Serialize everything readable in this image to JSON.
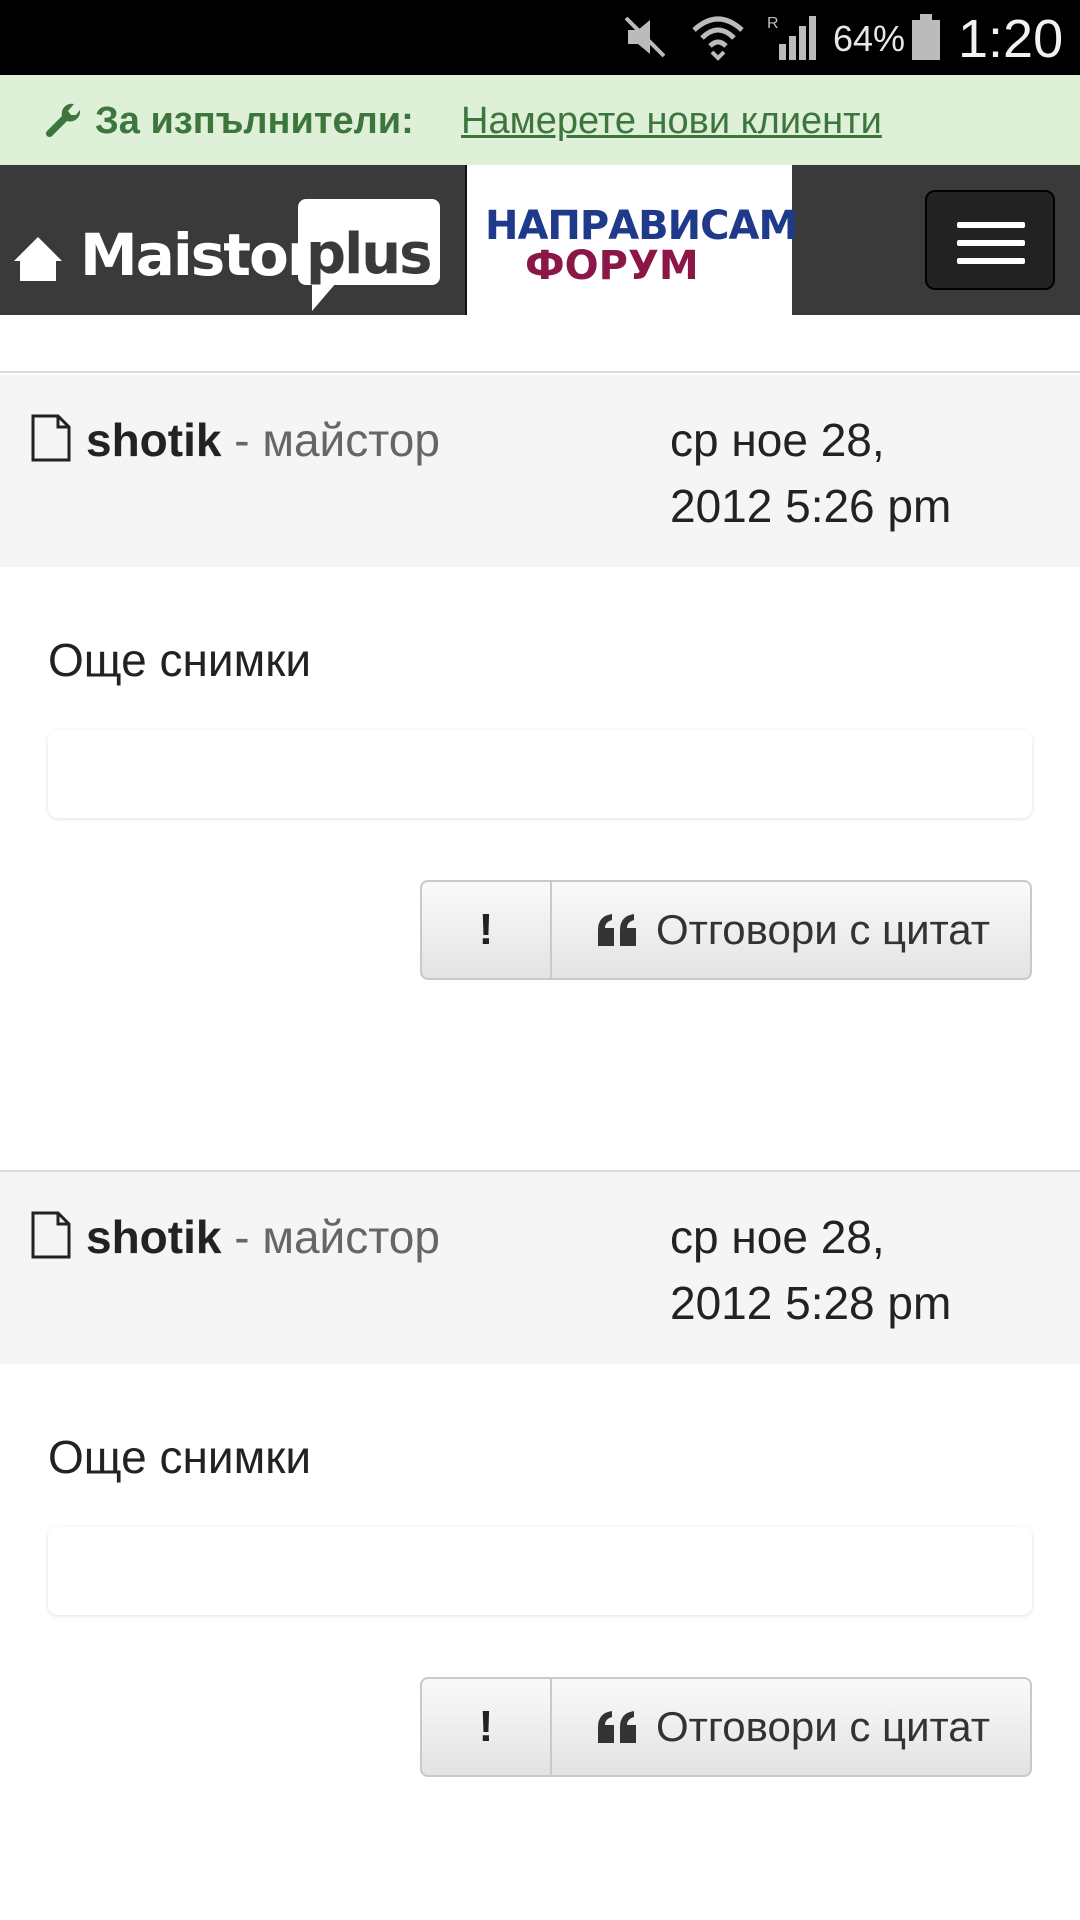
{
  "status_bar": {
    "battery": "64%",
    "time": "1:20",
    "icons": [
      "mute-icon",
      "wifi-icon",
      "signal-icon",
      "battery-icon"
    ]
  },
  "promo": {
    "label": "За изпълнители:",
    "link": "Намерете нови клиенти",
    "colors": {
      "background": "#dff0d8",
      "text": "#3c763d"
    }
  },
  "header": {
    "logo_maistor": "MaistorPlus",
    "logo_forum_top": "НАПРАВИСАМ",
    "logo_forum_bottom": "ФОРУМ",
    "menu_icon": "hamburger-icon"
  },
  "posts": [
    {
      "author": "shotik",
      "role": " - майстор",
      "date_line1": "ср ное 28,",
      "date_line2": "2012 5:26 pm",
      "text": "Още снимки",
      "report_label": "!",
      "quote_label": "Отговори с цитат"
    },
    {
      "author": "shotik",
      "role": " - майстор",
      "date_line1": "ср ное 28,",
      "date_line2": "2012 5:28 pm",
      "text": "Още снимки",
      "report_label": "!",
      "quote_label": "Отговори с цитат"
    }
  ]
}
